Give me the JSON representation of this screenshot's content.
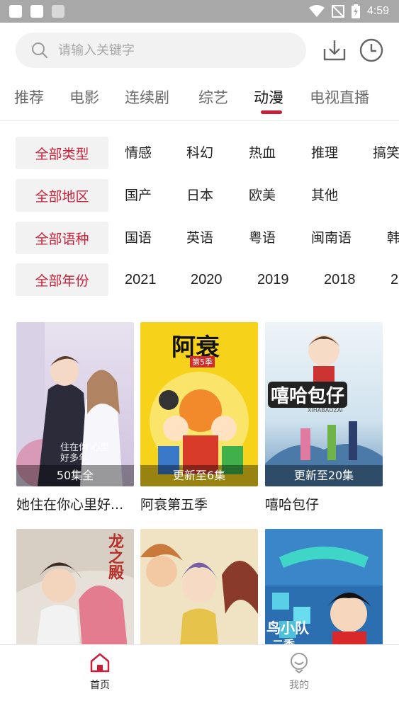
{
  "status_bar": {
    "time": "4:59"
  },
  "search": {
    "placeholder": "请输入关键字"
  },
  "header_icons": {
    "download": "download-icon",
    "history": "clock-icon"
  },
  "tabs": [
    {
      "label": "推荐",
      "active": false
    },
    {
      "label": "电影",
      "active": false
    },
    {
      "label": "连续剧",
      "active": false
    },
    {
      "label": "综艺",
      "active": false
    },
    {
      "label": "动漫",
      "active": true
    },
    {
      "label": "电视直播",
      "active": false
    }
  ],
  "filters": [
    {
      "selected": "全部类型",
      "options": [
        "情感",
        "科幻",
        "热血",
        "推理",
        "搞笑"
      ]
    },
    {
      "selected": "全部地区",
      "options": [
        "国产",
        "日本",
        "欧美",
        "其他"
      ]
    },
    {
      "selected": "全部语种",
      "options": [
        "国语",
        "英语",
        "粤语",
        "闽南语",
        "韩"
      ]
    },
    {
      "selected": "全部年份",
      "options": [
        "2021",
        "2020",
        "2019",
        "2018",
        "2"
      ]
    }
  ],
  "items": [
    {
      "title": "她住在你心里好...",
      "episodes": "50集全",
      "poster_text": "住在你 心里好多年"
    },
    {
      "title": "阿衰第五季",
      "episodes": "更新至6集",
      "poster_text": "阿衰",
      "poster_sub": "第5季"
    },
    {
      "title": "嘻哈包仔",
      "episodes": "更新至20集",
      "poster_text": "嘻哈包仔",
      "poster_sub": "XIHABAOZAI"
    },
    {
      "title": "",
      "episodes": "",
      "poster_text": "龙之殿"
    },
    {
      "title": "",
      "episodes": "",
      "poster_text": ""
    },
    {
      "title": "",
      "episodes": "",
      "poster_text": "鸟小队",
      "poster_sub": "二季"
    }
  ],
  "bottom_nav": [
    {
      "label": "首页",
      "active": true
    },
    {
      "label": "我的",
      "active": false
    }
  ],
  "colors": {
    "accent": "#c9203a",
    "status_bar": "#a8a8a8",
    "chip_bg": "#f2f2f2"
  }
}
